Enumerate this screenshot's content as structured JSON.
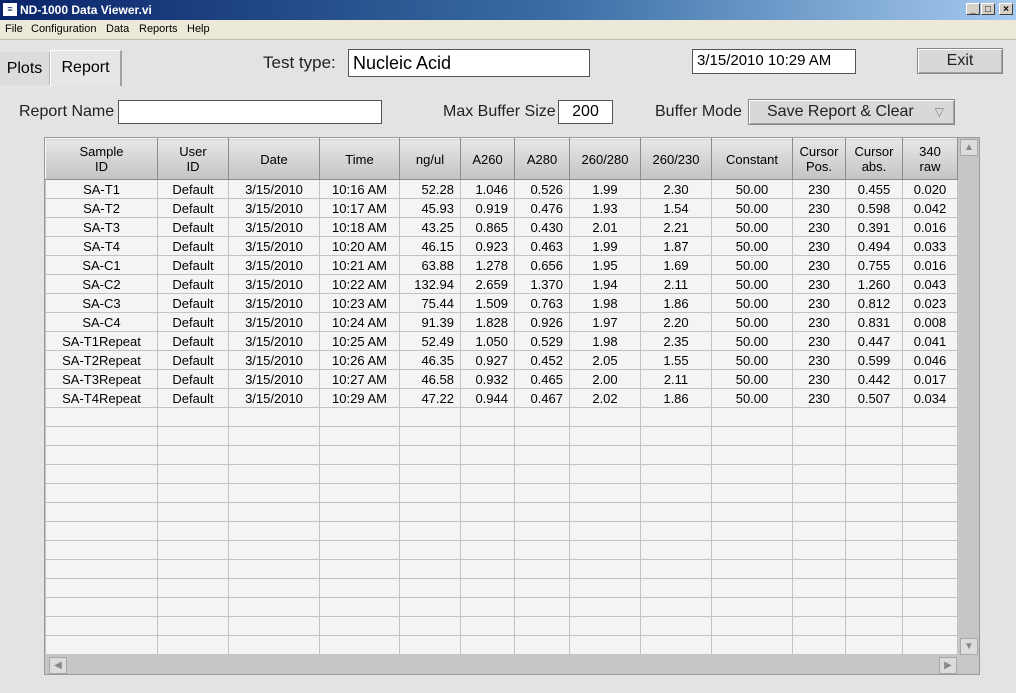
{
  "window": {
    "title": "ND-1000 Data Viewer.vi",
    "icon": "labview-app-icon"
  },
  "menu": [
    "File",
    "Configuration",
    "Data",
    "Reports",
    "Help"
  ],
  "tabs": [
    {
      "label": "Plots",
      "selected": false
    },
    {
      "label": "Report",
      "selected": true
    }
  ],
  "header": {
    "test_type_label": "Test type:",
    "test_type_value": "Nucleic Acid",
    "datetime": "3/15/2010  10:29 AM",
    "exit_label": "Exit"
  },
  "controls": {
    "report_name_label": "Report Name",
    "report_name_value": "",
    "max_buffer_label": "Max Buffer Size",
    "max_buffer_value": "200",
    "buffer_mode_label": "Buffer Mode",
    "buffer_mode_value": "Save Report & Clear"
  },
  "table": {
    "columns": [
      [
        "Sample",
        "ID"
      ],
      [
        "User",
        "ID"
      ],
      [
        "Date",
        ""
      ],
      [
        "Time",
        ""
      ],
      [
        "ng/ul",
        ""
      ],
      [
        "A260",
        ""
      ],
      [
        "A280",
        ""
      ],
      [
        "260/280",
        ""
      ],
      [
        "260/230",
        ""
      ],
      [
        "Constant",
        ""
      ],
      [
        "Cursor",
        "Pos."
      ],
      [
        "Cursor",
        "abs."
      ],
      [
        "340",
        "raw"
      ]
    ],
    "rows": [
      [
        "SA-T1",
        "Default",
        "3/15/2010",
        "10:16 AM",
        "52.28",
        "1.046",
        "0.526",
        "1.99",
        "2.30",
        "50.00",
        "230",
        "0.455",
        "0.020"
      ],
      [
        "SA-T2",
        "Default",
        "3/15/2010",
        "10:17 AM",
        "45.93",
        "0.919",
        "0.476",
        "1.93",
        "1.54",
        "50.00",
        "230",
        "0.598",
        "0.042"
      ],
      [
        "SA-T3",
        "Default",
        "3/15/2010",
        "10:18 AM",
        "43.25",
        "0.865",
        "0.430",
        "2.01",
        "2.21",
        "50.00",
        "230",
        "0.391",
        "0.016"
      ],
      [
        "SA-T4",
        "Default",
        "3/15/2010",
        "10:20 AM",
        "46.15",
        "0.923",
        "0.463",
        "1.99",
        "1.87",
        "50.00",
        "230",
        "0.494",
        "0.033"
      ],
      [
        "SA-C1",
        "Default",
        "3/15/2010",
        "10:21 AM",
        "63.88",
        "1.278",
        "0.656",
        "1.95",
        "1.69",
        "50.00",
        "230",
        "0.755",
        "0.016"
      ],
      [
        "SA-C2",
        "Default",
        "3/15/2010",
        "10:22 AM",
        "132.94",
        "2.659",
        "1.370",
        "1.94",
        "2.11",
        "50.00",
        "230",
        "1.260",
        "0.043"
      ],
      [
        "SA-C3",
        "Default",
        "3/15/2010",
        "10:23 AM",
        "75.44",
        "1.509",
        "0.763",
        "1.98",
        "1.86",
        "50.00",
        "230",
        "0.812",
        "0.023"
      ],
      [
        "SA-C4",
        "Default",
        "3/15/2010",
        "10:24 AM",
        "91.39",
        "1.828",
        "0.926",
        "1.97",
        "2.20",
        "50.00",
        "230",
        "0.831",
        "0.008"
      ],
      [
        "SA-T1Repeat",
        "Default",
        "3/15/2010",
        "10:25 AM",
        "52.49",
        "1.050",
        "0.529",
        "1.98",
        "2.35",
        "50.00",
        "230",
        "0.447",
        "0.041"
      ],
      [
        "SA-T2Repeat",
        "Default",
        "3/15/2010",
        "10:26 AM",
        "46.35",
        "0.927",
        "0.452",
        "2.05",
        "1.55",
        "50.00",
        "230",
        "0.599",
        "0.046"
      ],
      [
        "SA-T3Repeat",
        "Default",
        "3/15/2010",
        "10:27 AM",
        "46.58",
        "0.932",
        "0.465",
        "2.00",
        "2.11",
        "50.00",
        "230",
        "0.442",
        "0.017"
      ],
      [
        "SA-T4Repeat",
        "Default",
        "3/15/2010",
        "10:29 AM",
        "47.22",
        "0.944",
        "0.467",
        "2.02",
        "1.86",
        "50.00",
        "230",
        "0.507",
        "0.034"
      ]
    ],
    "empty_rows": 13,
    "numeric_columns": [
      4,
      5,
      6
    ]
  },
  "colors": {
    "title_start": "#0a246a",
    "title_end": "#a6caf0",
    "panel": "#e3e3e3",
    "cell": "#f4f4f4"
  }
}
